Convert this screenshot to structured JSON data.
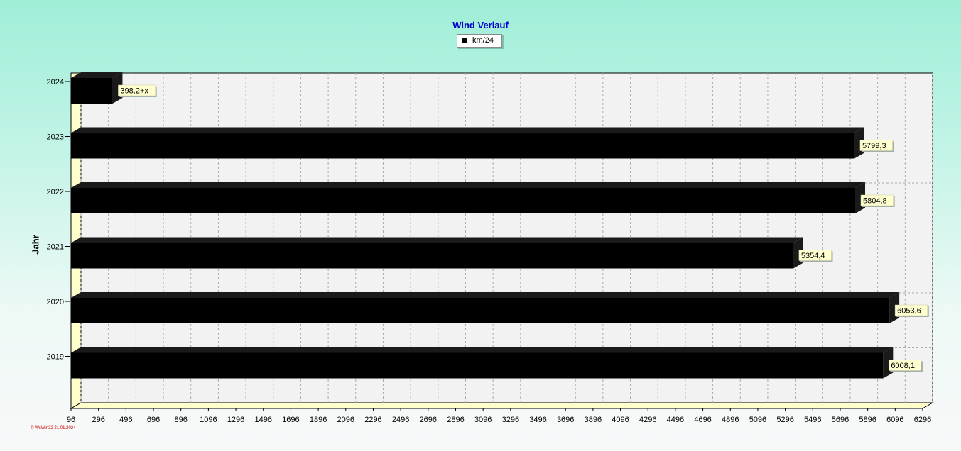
{
  "chart_data": {
    "type": "bar",
    "orientation": "horizontal",
    "title": "Wind Verlauf",
    "ylabel": "Jahr",
    "xlabel": "",
    "legend": {
      "entries": [
        "km/24"
      ],
      "placement": "top-center"
    },
    "categories": [
      "2024",
      "2023",
      "2022",
      "2021",
      "2020",
      "2019"
    ],
    "series": [
      {
        "name": "km/24",
        "color": "#000000",
        "values": [
          398.2,
          5799.3,
          5804.8,
          5354.4,
          6053.6,
          6008.1
        ],
        "labels": [
          "398,2+x",
          "5799,3",
          "5804,8",
          "5354,4",
          "6053,6",
          "6008,1"
        ]
      }
    ],
    "xlim": [
      96,
      6296
    ],
    "xticks": [
      96,
      296,
      496,
      696,
      896,
      1096,
      1296,
      1496,
      1696,
      1896,
      2096,
      2296,
      2496,
      2696,
      2896,
      3096,
      3296,
      3496,
      3696,
      3896,
      4096,
      4296,
      4496,
      4696,
      4896,
      5096,
      5296,
      5496,
      5696,
      5896,
      6096,
      6296
    ],
    "grid": true,
    "three_d": true,
    "data_label_background": "#ffffd0",
    "wall_color": "#ffffcc",
    "plot_background": "#f2f2f2"
  },
  "footer": {
    "credit": "© WsWin32  21.01.2024"
  }
}
